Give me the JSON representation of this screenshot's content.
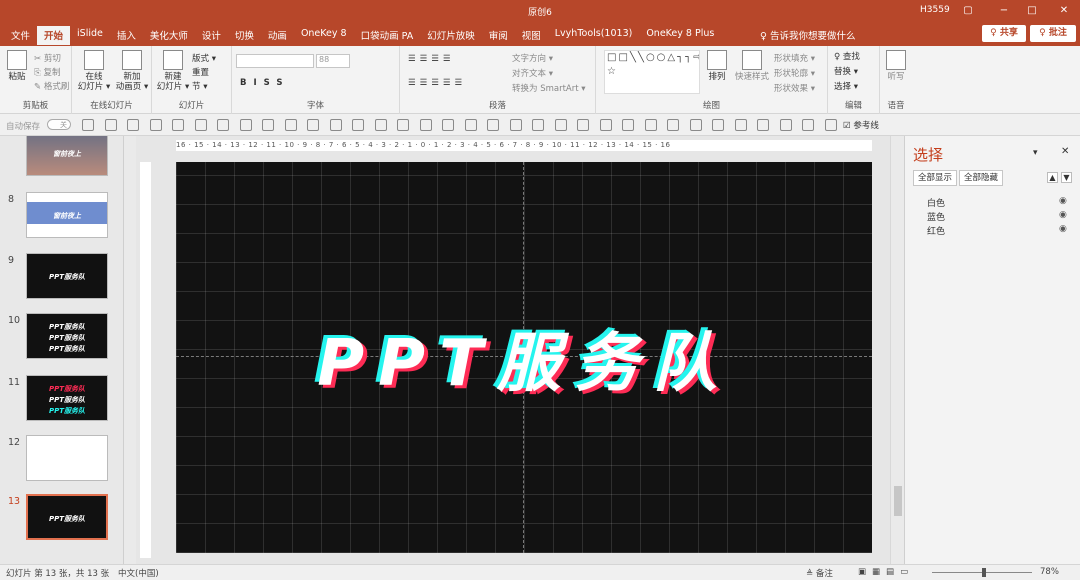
{
  "titlebar": {
    "doc_name": "原创6",
    "user": "H3559",
    "minimize": "−",
    "restore": "▢",
    "maximize": "□",
    "close": "✕"
  },
  "tabs": [
    "文件",
    "开始",
    "iSlide",
    "插入",
    "美化大师",
    "设计",
    "切换",
    "动画",
    "OneKey 8",
    "口袋动画 PA",
    "幻灯片放映",
    "审阅",
    "视图",
    "LvyhTools(1013)",
    "OneKey 8 Plus"
  ],
  "tell_me": "♀ 告诉我你想要做什么",
  "share_label": "♀ 共享",
  "comments_label": "♀ 批注",
  "ribbon": {
    "clipboard": {
      "paste": "粘贴",
      "cut": "✂ 剪切",
      "copy": "⎘ 复制",
      "painter": "✎ 格式刷",
      "label": "剪贴板"
    },
    "online": {
      "online_slides": "在线\n幻灯片 ▾",
      "new_anim": "新加\n动画页 ▾",
      "label": "在线幻灯片"
    },
    "slides": {
      "new_slide": "新建\n幻灯片 ▾",
      "layout": "版式 ▾",
      "reset": "重置",
      "section": "节 ▾",
      "label": "幻灯片"
    },
    "font": {
      "size": "88",
      "label": "字体"
    },
    "paragraph": {
      "text_dir": "文字方向 ▾",
      "align_text": "对齐文本 ▾",
      "smartart": "转换为 SmartArt ▾",
      "label": "段落"
    },
    "drawing": {
      "arrange": "排列",
      "quick_styles": "快速样式",
      "fill": "形状填充 ▾",
      "outline": "形状轮廓 ▾",
      "effects": "形状效果 ▾",
      "label": "绘图"
    },
    "editing": {
      "find": "♀ 查找",
      "replace": "替换 ▾",
      "select": "选择 ▾",
      "label": "编辑"
    },
    "voice": {
      "dictate": "听写",
      "label": "语音"
    }
  },
  "qat": {
    "autosave": "自动保存",
    "autosave_state": "关",
    "guides": "☑ 参考线"
  },
  "slides": [
    {
      "num": "",
      "type": "photo",
      "lines": [
        "窗前夜上"
      ]
    },
    {
      "num": "8",
      "type": "light",
      "lines": [
        "窗前夜上"
      ]
    },
    {
      "num": "9",
      "type": "dark",
      "lines": [
        "PPT服务队"
      ]
    },
    {
      "num": "10",
      "type": "dark",
      "lines": [
        "PPT服务队",
        "PPT服务队",
        "PPT服务队"
      ]
    },
    {
      "num": "11",
      "type": "dark",
      "lines": [
        "PPT服务队",
        "PPT服务队",
        "PPT服务队"
      ]
    },
    {
      "num": "12",
      "type": "light",
      "lines": []
    },
    {
      "num": "13",
      "type": "dark",
      "lines": [
        "PPT服务队"
      ],
      "active": true
    }
  ],
  "ruler": "16 · 15 · 14 · 13 · 12 · 11 · 10 · 9 · 8 · 7 · 6 · 5 · 4 · 3 · 2 · 1 · 0 · 1 · 2 · 3 · 4 · 5 · 6 · 7 · 8 · 9 · 10 · 11 · 12 · 13 · 14 · 15 · 16",
  "slide_text": "PPT服务队",
  "selection_pane": {
    "title": "选择",
    "show_all": "全部显示",
    "hide_all": "全部隐藏",
    "items": [
      "白色",
      "蓝色",
      "红色"
    ]
  },
  "statusbar": {
    "slide_info": "幻灯片 第 13 张，共 13 张",
    "language": "中文(中国)",
    "notes": "≜ 备注",
    "zoom": "78%"
  }
}
